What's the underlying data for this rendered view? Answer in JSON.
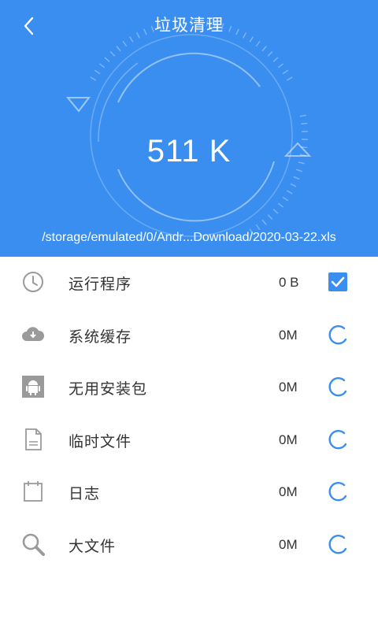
{
  "header": {
    "title": "垃圾清理",
    "size": "511 K",
    "scan_path": "/storage/emulated/0/Andr...Download/2020-03-22.xls",
    "bg_color": "#3a8ef0"
  },
  "items": [
    {
      "label": "运行程序",
      "value": "0 B",
      "icon": "clock-icon",
      "state": "checked"
    },
    {
      "label": "系统缓存",
      "value": "0M",
      "icon": "cloud-download-icon",
      "state": "loading"
    },
    {
      "label": "无用安装包",
      "value": "0M",
      "icon": "android-icon",
      "state": "loading"
    },
    {
      "label": "临时文件",
      "value": "0M",
      "icon": "file-icon",
      "state": "loading"
    },
    {
      "label": "日志",
      "value": "0M",
      "icon": "calendar-icon",
      "state": "loading"
    },
    {
      "label": "大文件",
      "value": "0M",
      "icon": "search-icon",
      "state": "loading"
    }
  ],
  "colors": {
    "accent": "#3a8ef0",
    "icon_gray": "#9a9a9a",
    "text": "#333333"
  }
}
